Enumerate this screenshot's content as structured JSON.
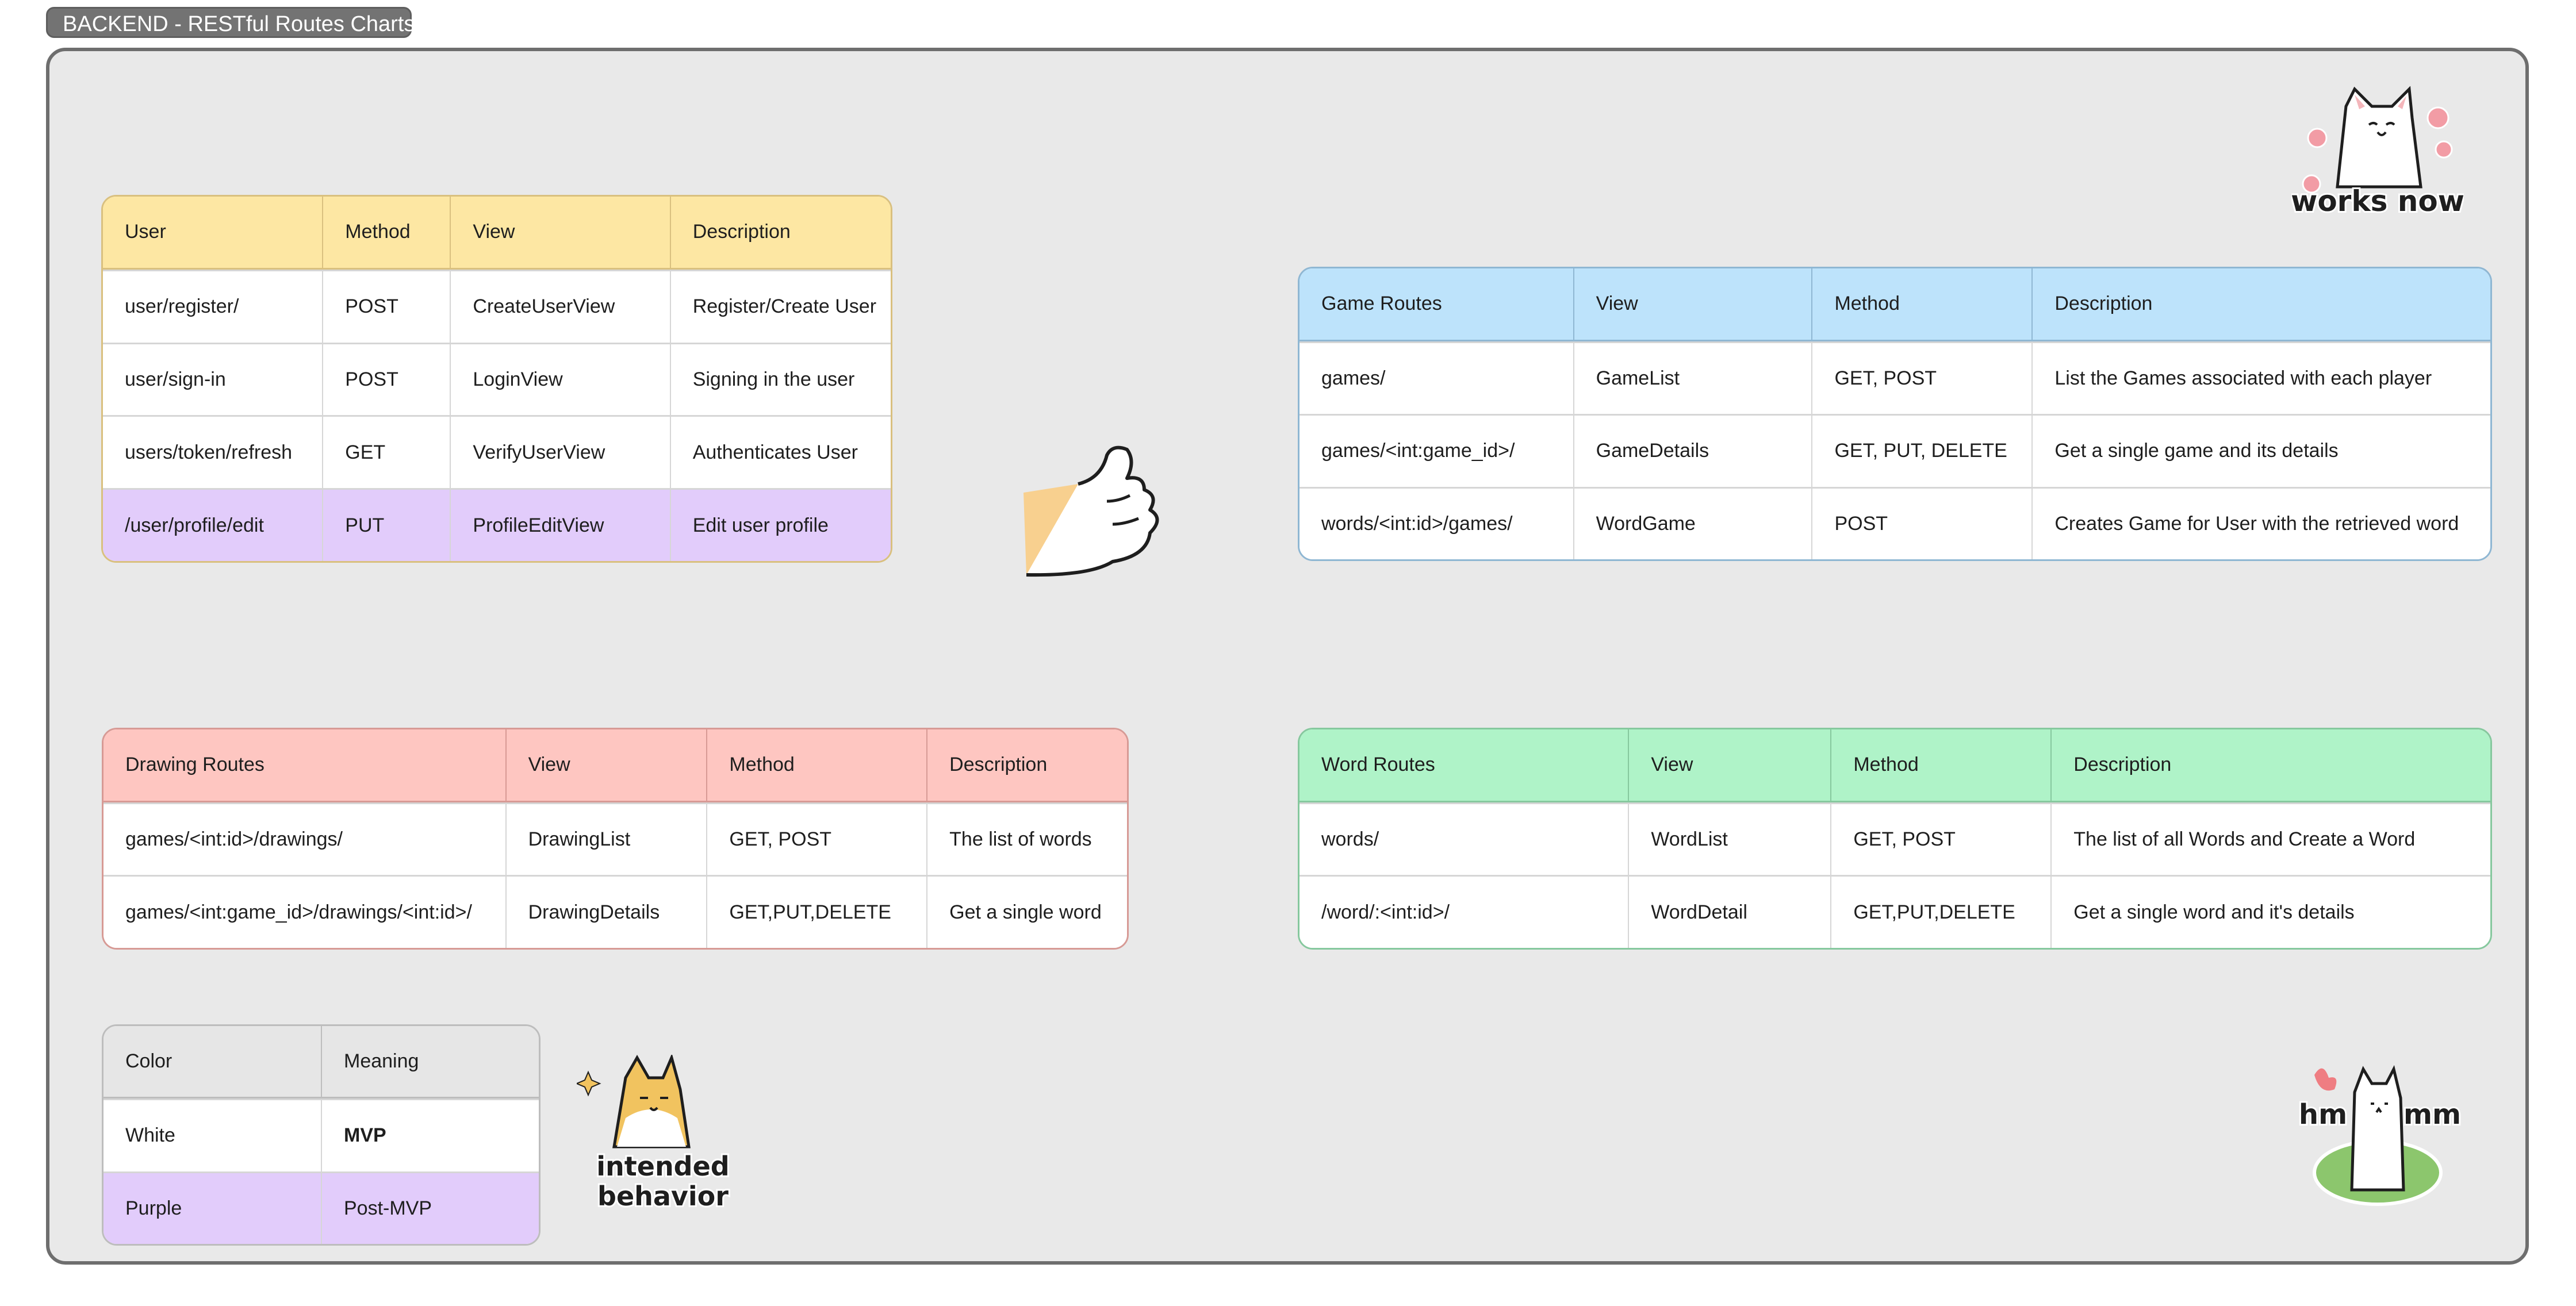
{
  "board": {
    "title": "BACKEND - RESTful Routes Charts"
  },
  "tables": {
    "user": {
      "header_color": "#fde7a3",
      "border_color": "#d9c07f",
      "headers": [
        "User",
        "Method",
        "View",
        "Description"
      ],
      "rows": [
        {
          "cells": [
            "user/register/",
            "POST",
            "CreateUserView",
            "Register/Create User"
          ],
          "tier": "mvp"
        },
        {
          "cells": [
            "user/sign-in",
            "POST",
            "LoginView",
            "Signing in the user"
          ],
          "tier": "mvp"
        },
        {
          "cells": [
            "users/token/refresh",
            "GET",
            "VerifyUserView",
            "Authenticates User"
          ],
          "tier": "mvp"
        },
        {
          "cells": [
            "/user/profile/edit",
            "PUT",
            "ProfileEditView",
            "Edit user profile"
          ],
          "tier": "post-mvp"
        }
      ]
    },
    "game": {
      "header_color": "#bde3fb",
      "border_color": "#8fb7d3",
      "headers": [
        "Game Routes",
        "View",
        "Method",
        "Description"
      ],
      "rows": [
        {
          "cells": [
            "games/",
            "GameList",
            "GET, POST",
            "List the Games associated with each player"
          ],
          "tier": "mvp"
        },
        {
          "cells": [
            "games/<int:game_id>/",
            "GameDetails",
            "GET, PUT, DELETE",
            "Get a single game and its details"
          ],
          "tier": "mvp"
        },
        {
          "cells": [
            "words/<int:id>/games/",
            "WordGame",
            "POST",
            "Creates Game for User with the retrieved word"
          ],
          "tier": "mvp"
        }
      ]
    },
    "drawing": {
      "header_color": "#fec6c1",
      "border_color": "#d79a95",
      "headers": [
        "Drawing Routes",
        "View",
        "Method",
        "Description"
      ],
      "rows": [
        {
          "cells": [
            "games/<int:id>/drawings/",
            "DrawingList",
            "GET, POST",
            "The list of words"
          ],
          "tier": "mvp"
        },
        {
          "cells": [
            "games/<int:game_id>/drawings/<int:id>/",
            "DrawingDetails",
            "GET,PUT,DELETE",
            "Get a single word"
          ],
          "tier": "mvp"
        }
      ]
    },
    "word": {
      "header_color": "#aff3c8",
      "border_color": "#86c89e",
      "headers": [
        "Word Routes",
        "View",
        "Method",
        "Description"
      ],
      "rows": [
        {
          "cells": [
            "words/",
            "WordList",
            "GET, POST",
            "The list of all Words and Create a Word"
          ],
          "tier": "mvp"
        },
        {
          "cells": [
            "/word/:<int:id>/",
            "WordDetail",
            "GET,PUT,DELETE",
            "Get a single word and it's details"
          ],
          "tier": "mvp"
        }
      ]
    },
    "legend": {
      "header_color": "#e6e6e6",
      "border_color": "#bdbdbd",
      "headers": [
        "Color",
        "Meaning"
      ],
      "rows": [
        {
          "cells": [
            "White",
            "MVP"
          ],
          "tier": "mvp",
          "bold_meaning": true
        },
        {
          "cells": [
            "Purple",
            "Post-MVP"
          ],
          "tier": "post-mvp"
        }
      ]
    }
  },
  "stickers": {
    "works_now": "works now",
    "intended": [
      "intended",
      "behavior"
    ],
    "hmm": [
      "hm",
      "mm"
    ]
  },
  "colors": {
    "post_mvp": "#e2ccfb",
    "canvas": "#e9e9e9"
  }
}
